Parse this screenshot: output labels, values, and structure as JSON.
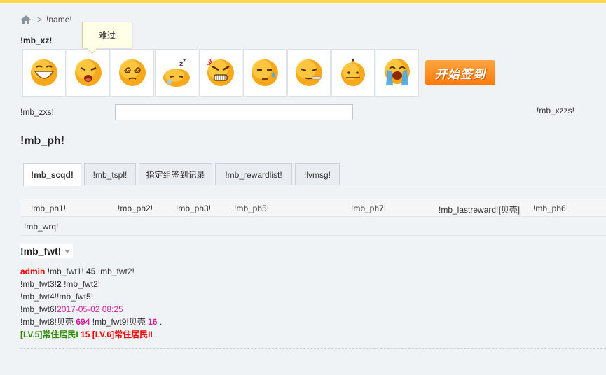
{
  "breadcrumb": {
    "home_icon": "home-icon",
    "separator": ">",
    "current": "!name!"
  },
  "mood_section": {
    "label": "!mb_xz!",
    "tooltip": "难过",
    "moods": [
      {
        "name": "grin",
        "icon": "grin-face-icon"
      },
      {
        "name": "sad",
        "icon": "sad-face-icon"
      },
      {
        "name": "dizzy",
        "icon": "dizzy-face-icon"
      },
      {
        "name": "sleepy",
        "icon": "sleepy-face-icon"
      },
      {
        "name": "angry",
        "icon": "angry-face-icon"
      },
      {
        "name": "sweat",
        "icon": "sweat-face-icon"
      },
      {
        "name": "smoke",
        "icon": "smoke-face-icon"
      },
      {
        "name": "bored",
        "icon": "bored-face-icon"
      },
      {
        "name": "cry",
        "icon": "cry-face-icon"
      }
    ],
    "sign_button": "开始签到"
  },
  "say": {
    "label": "!mb_zxs!",
    "input_value": "",
    "hint": "!mb_xzzs!"
  },
  "ranking": {
    "title": "!mb_ph!",
    "tabs": [
      {
        "label": "!mb_scqd!",
        "active": true
      },
      {
        "label": "!mb_tspl!",
        "active": false
      },
      {
        "label": "指定组签到记录",
        "active": false
      },
      {
        "label": "!mb_rewardlist!",
        "active": false
      },
      {
        "label": "!lvmsg!",
        "active": false
      }
    ],
    "columns": [
      "!mb_ph1!",
      "!mb_ph2!",
      "!mb_ph3!",
      "!mb_ph5!",
      "!mb_ph7!",
      "!mb_lastreward![贝壳]",
      "!mb_ph6!"
    ],
    "empty_text": "!mb_wrq!"
  },
  "owner": {
    "title": "!mb_fwt!",
    "username": "admin",
    "l1_a": "!mb_fwt1!",
    "days": "45",
    "l1_b": "!mb_fwt2!",
    "l2_a": "!mb_fwt3!",
    "count": "2",
    "l2_b": "!mb_fwt2!",
    "l3": "!mb_fwt4!!mb_fwt5!",
    "l4_a": "!mb_fwt6!",
    "last_time": "2017-05-02 08:25",
    "l5_a": "!mb_fwt8!贝壳",
    "total_reward": "694",
    "l5_b": "!mb_fwt9!贝壳",
    "last_reward": "16",
    "period": ".",
    "level_current": "[LV.5]常住居民I",
    "level_days": "15",
    "level_next": "[LV.6]常住居民II",
    "period2": "."
  },
  "colors": {
    "accent": "#ffd84a",
    "button": "#ff8a1c",
    "red": "#e00000",
    "magenta": "#d61b9c",
    "green": "#2d8a00"
  }
}
